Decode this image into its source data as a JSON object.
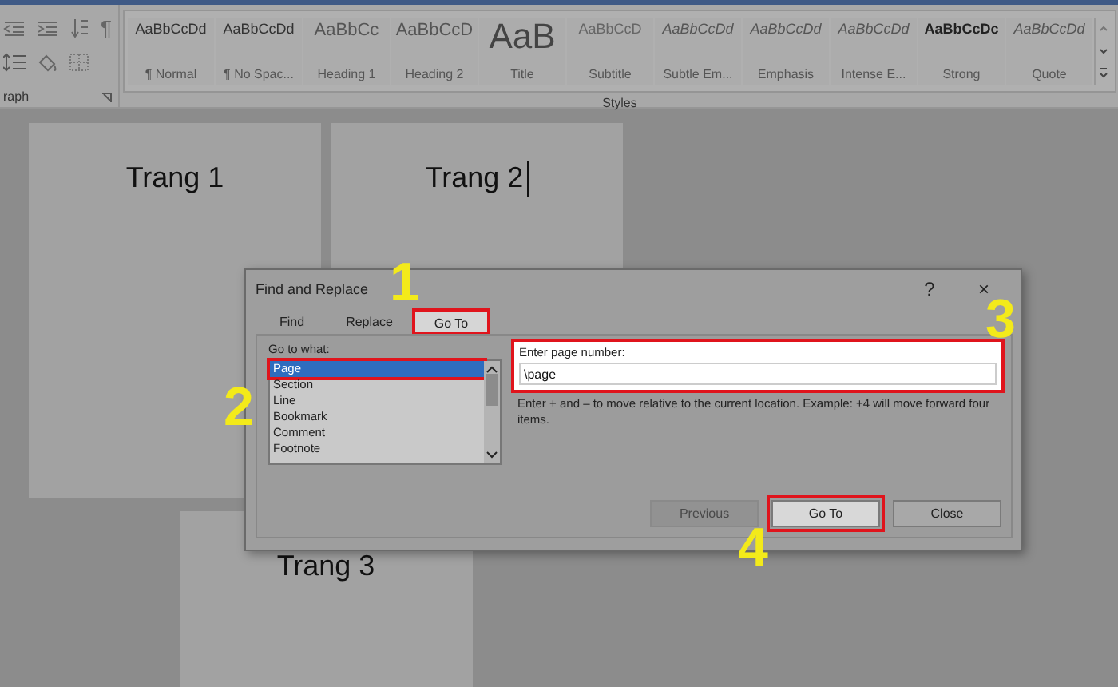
{
  "ribbon": {
    "paragraph_group": {
      "label": "raph",
      "pilcrow": "¶"
    },
    "styles_group": {
      "label": "Styles",
      "items": [
        {
          "sample": "AaBbCcDd",
          "name": "¶ Normal",
          "kind": "plain"
        },
        {
          "sample": "AaBbCcDd",
          "name": "¶ No Spac...",
          "kind": "plain"
        },
        {
          "sample": "AaBbCc",
          "name": "Heading 1",
          "kind": "heading"
        },
        {
          "sample": "AaBbCcD",
          "name": "Heading 2",
          "kind": "heading"
        },
        {
          "sample": "AaB",
          "name": "Title",
          "kind": "title"
        },
        {
          "sample": "AaBbCcD",
          "name": "Subtitle",
          "kind": "subtle"
        },
        {
          "sample": "AaBbCcDd",
          "name": "Subtle Em...",
          "kind": "italic"
        },
        {
          "sample": "AaBbCcDd",
          "name": "Emphasis",
          "kind": "italic"
        },
        {
          "sample": "AaBbCcDd",
          "name": "Intense E...",
          "kind": "italic"
        },
        {
          "sample": "AaBbCcDc",
          "name": "Strong",
          "kind": "bold"
        },
        {
          "sample": "AaBbCcDd",
          "name": "Quote",
          "kind": "italic"
        }
      ]
    }
  },
  "pages": [
    {
      "text": "Trang 1",
      "cursor": false
    },
    {
      "text": "Trang 2",
      "cursor": true
    },
    {
      "text": "Trang 3",
      "cursor": false
    }
  ],
  "dialog": {
    "title": "Find and Replace",
    "help": "?",
    "close": "×",
    "tabs": [
      {
        "label": "Find",
        "selected": false,
        "highlighted": false
      },
      {
        "label": "Replace",
        "selected": false,
        "highlighted": false
      },
      {
        "label": "Go To",
        "selected": true,
        "highlighted": true
      }
    ],
    "go_to_what": {
      "label": "Go to what:",
      "items": [
        {
          "label": "Page",
          "selected": true,
          "highlighted": true
        },
        {
          "label": "Section",
          "selected": false,
          "highlighted": false
        },
        {
          "label": "Line",
          "selected": false,
          "highlighted": false
        },
        {
          "label": "Bookmark",
          "selected": false,
          "highlighted": false
        },
        {
          "label": "Comment",
          "selected": false,
          "highlighted": false
        },
        {
          "label": "Footnote",
          "selected": false,
          "highlighted": false
        }
      ]
    },
    "page_number": {
      "label": "Enter page number:",
      "value": "\\page",
      "highlighted": true
    },
    "hint": "Enter + and – to move relative to the current location. Example: +4 will move forward four items.",
    "buttons": [
      {
        "label": "Previous",
        "disabled": true,
        "highlighted": false
      },
      {
        "label": "Go To",
        "disabled": false,
        "highlighted": true
      },
      {
        "label": "Close",
        "disabled": false,
        "highlighted": false
      }
    ]
  },
  "annotations": [
    "1",
    "2",
    "3",
    "4"
  ]
}
